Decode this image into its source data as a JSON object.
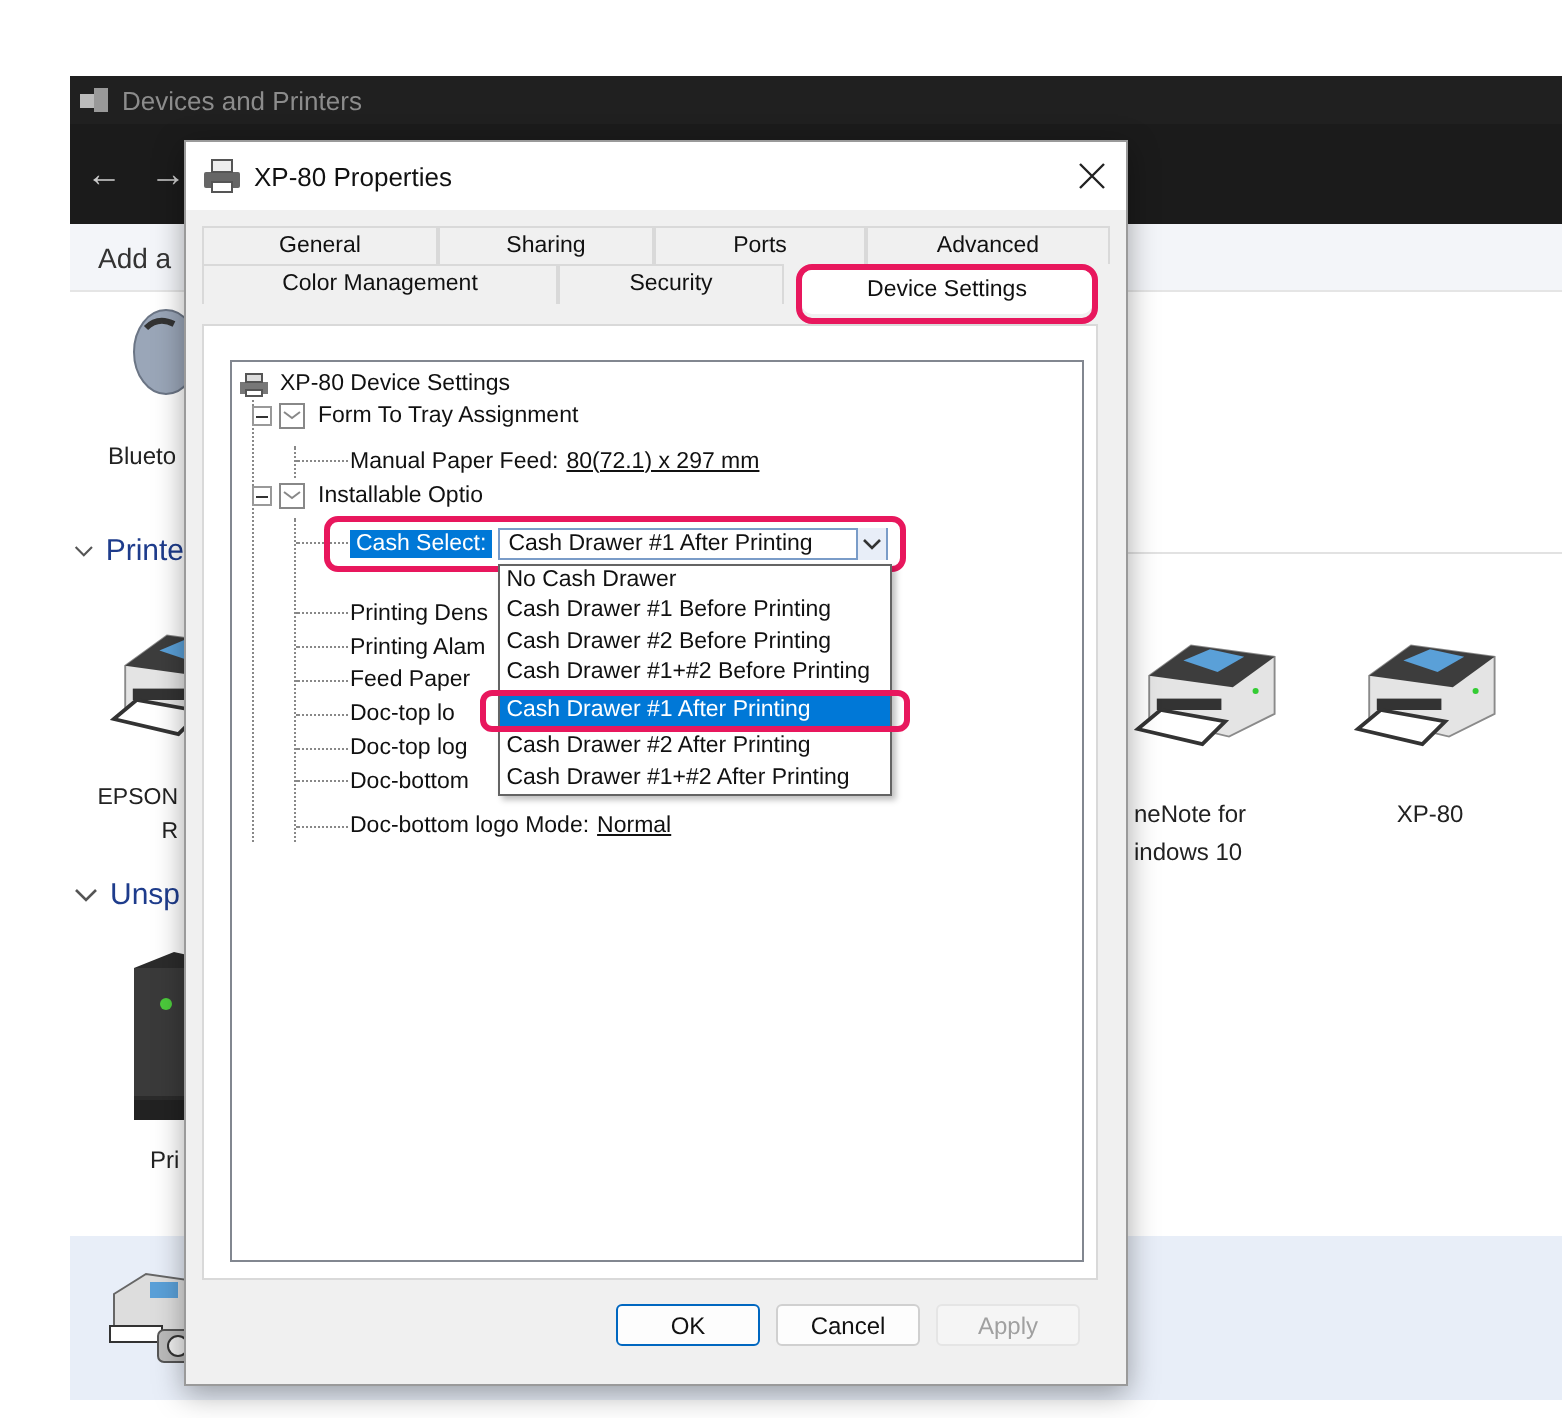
{
  "explorer": {
    "title": "Devices and Printers",
    "command": "Add a",
    "left_items": [
      {
        "kind": "mouse",
        "lines": [
          "Blueto"
        ]
      },
      {
        "kind": "section",
        "lines": [
          "Printe"
        ]
      },
      {
        "kind": "printer",
        "lines": [
          "EPSON",
          "R"
        ]
      },
      {
        "kind": "section",
        "lines": [
          "Unsp"
        ]
      },
      {
        "kind": "tower",
        "lines": [
          "Pri"
        ]
      }
    ],
    "right_items": [
      {
        "kind": "printer",
        "lines": [
          "neNote for",
          "indows 10"
        ]
      },
      {
        "kind": "printer",
        "lines": [
          "XP-80"
        ]
      }
    ],
    "bottom_row": {
      "selected": true
    },
    "nav": [
      "←",
      "→"
    ]
  },
  "dialog": {
    "title": "XP-80 Properties",
    "tab_rows": [
      [
        {
          "label": "General",
          "selected": false
        },
        {
          "label": "Sharing",
          "selected": false
        },
        {
          "label": "Ports",
          "selected": false
        },
        {
          "label": "Advanced",
          "selected": false
        }
      ],
      [
        {
          "label": "Color Management",
          "selected": false
        },
        {
          "label": "Security",
          "selected": false
        },
        {
          "label": "Device Settings",
          "selected": true
        }
      ]
    ],
    "tree": {
      "label": "XP-80 Device Settings",
      "kind": "root",
      "selected": false,
      "children": [
        {
          "label": "Form To Tray Assignment",
          "kind": "group",
          "expanded": true,
          "selected": false,
          "children": [
            {
              "label": "Manual Paper Feed:",
              "value": "80(72.1) x 297 mm",
              "kind": "setting",
              "selected": false
            }
          ]
        },
        {
          "label": "Installable Optio",
          "kind": "group",
          "expanded": true,
          "selected": false,
          "children": [
            {
              "label": "Cash Select:",
              "kind": "combo",
              "selected": true,
              "value": "Cash Drawer #1 After Printing",
              "options": [
                {
                  "label": "No Cash Drawer",
                  "selected": false
                },
                {
                  "label": "Cash Drawer #1 Before Printing",
                  "selected": false
                },
                {
                  "label": "Cash Drawer #2 Before Printing",
                  "selected": false
                },
                {
                  "label": "Cash Drawer #1+#2 Before Printing",
                  "selected": false
                },
                {
                  "label": "Cash Drawer #1 After Printing",
                  "selected": true
                },
                {
                  "label": "Cash Drawer #2 After Printing",
                  "selected": false
                },
                {
                  "label": "Cash Drawer #1+#2 After Printing",
                  "selected": false
                }
              ]
            },
            {
              "label": "Printing Dens",
              "kind": "setting",
              "selected": false
            },
            {
              "label": "Printing Alam",
              "kind": "setting",
              "selected": false
            },
            {
              "label": "Feed Paper",
              "kind": "setting",
              "selected": false
            },
            {
              "label": "Doc-top lo",
              "kind": "setting",
              "selected": false
            },
            {
              "label": "Doc-top log",
              "kind": "setting",
              "selected": false
            },
            {
              "label": "Doc-bottom",
              "kind": "setting",
              "selected": false
            },
            {
              "label": "Doc-bottom logo Mode:",
              "value": "Normal",
              "kind": "setting",
              "selected": false
            }
          ]
        }
      ]
    },
    "buttons": [
      {
        "label": "OK",
        "default": true,
        "disabled": false
      },
      {
        "label": "Cancel",
        "default": false,
        "disabled": false
      },
      {
        "label": "Apply",
        "default": false,
        "disabled": true
      }
    ]
  }
}
